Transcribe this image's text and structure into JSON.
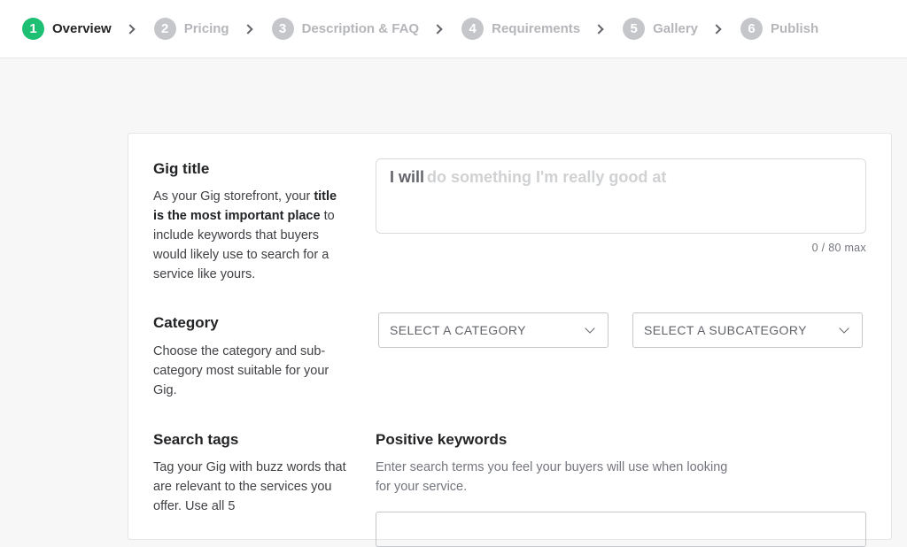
{
  "steps": [
    {
      "num": "1",
      "label": "Overview"
    },
    {
      "num": "2",
      "label": "Pricing"
    },
    {
      "num": "3",
      "label": "Description & FAQ"
    },
    {
      "num": "4",
      "label": "Requirements"
    },
    {
      "num": "5",
      "label": "Gallery"
    },
    {
      "num": "6",
      "label": "Publish"
    }
  ],
  "gig_title": {
    "heading": "Gig title",
    "desc_1": "As your Gig storefront, your ",
    "desc_bold": "title is the most important place",
    "desc_2": " to include keywords that buyers would likely use to search for a service like yours.",
    "prefix": "I will",
    "placeholder": "do something I'm really good at",
    "counter": "0 / 80 max"
  },
  "category": {
    "heading": "Category",
    "desc": "Choose the category and sub-category most suitable for your Gig.",
    "select_category": "SELECT A CATEGORY",
    "select_subcategory": "SELECT A SUBCATEGORY"
  },
  "search_tags": {
    "heading": "Search tags",
    "desc": "Tag your Gig with buzz words that are relevant to the services you offer. Use all 5",
    "keywords_heading": "Positive keywords",
    "keywords_desc": "Enter search terms you feel your buyers will use when looking for your service."
  }
}
